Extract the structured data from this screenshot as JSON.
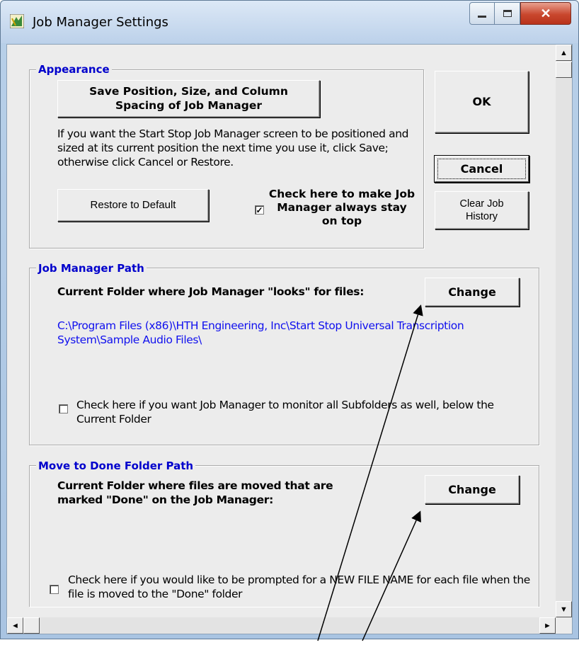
{
  "window": {
    "title": "Job Manager Settings"
  },
  "appearance": {
    "legend": "Appearance",
    "save_button": "Save Position, Size, and Column Spacing of Job Manager",
    "description": "If you want the  Start Stop Job Manager screen to be positioned and sized at its current position the next time you use it, click Save; otherwise click Cancel or Restore.",
    "restore_button": "Restore to Default",
    "on_top_checkbox": {
      "label": "Check here to make Job Manager always stay on top",
      "checked": true
    }
  },
  "side_buttons": {
    "ok": "OK",
    "cancel": "Cancel",
    "clear_history": "Clear Job History"
  },
  "job_manager_path": {
    "legend": "Job Manager Path",
    "label": "Current Folder where Job Manager \"looks\" for files:",
    "change_button": "Change",
    "path": "C:\\Program Files (x86)\\HTH Engineering, Inc\\Start Stop Universal Transcription System\\Sample Audio Files\\",
    "subfolders_checkbox": {
      "label": "Check here if you want Job Manager to monitor all Subfolders as well,  below the Current Folder",
      "checked": false
    }
  },
  "done_folder_path": {
    "legend": "Move to Done Folder Path",
    "label": "Current Folder where files are moved that are marked \"Done\" on the Job Manager:",
    "change_button": "Change",
    "rename_checkbox": {
      "label": "Check here if you would like to be prompted for a NEW FILE NAME for each file when the file is  moved to the \"Done\" folder",
      "checked": false
    }
  },
  "check_mark": "✓",
  "icons": {
    "app": "job-manager-app-icon",
    "minimize": "minimize-icon",
    "maximize": "maximize-icon",
    "close": "close-icon"
  }
}
